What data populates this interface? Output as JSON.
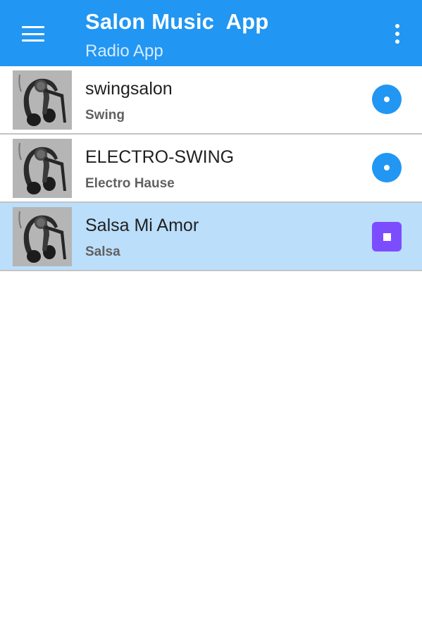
{
  "app_bar": {
    "title": "Salon Music  App",
    "subtitle": "Radio App",
    "menu_icon": "menu-icon",
    "overflow_icon": "more-vert-icon",
    "color": "#2196f3"
  },
  "stations": [
    {
      "name": "swingsalon",
      "genre": "Swing",
      "state": "idle",
      "action_icon": "play-circle-icon"
    },
    {
      "name": "ELECTRO-SWING",
      "genre": "Electro Hause",
      "state": "idle",
      "action_icon": "play-circle-icon"
    },
    {
      "name": "Salsa Mi Amor",
      "genre": "Salsa",
      "state": "playing",
      "action_icon": "stop-icon"
    }
  ],
  "colors": {
    "selected_row": "#bbdefb",
    "play_button": "#2196f3",
    "stop_button": "#7c4dff"
  }
}
